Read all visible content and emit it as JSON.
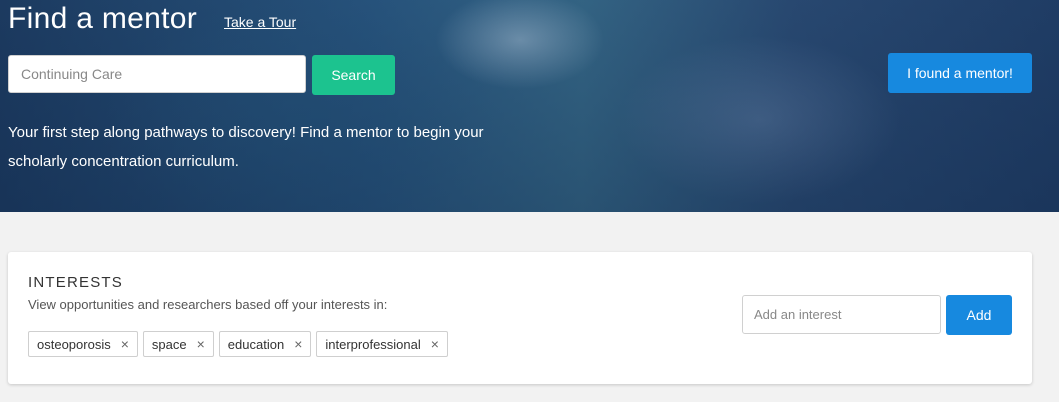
{
  "header": {
    "title": "Find a mentor",
    "tour_link": "Take a Tour",
    "search_placeholder": "Continuing Care",
    "search_button": "Search",
    "found_button": "I found a mentor!",
    "tagline": "Your first step along pathways to discovery! Find a mentor to begin your scholarly concentration curriculum."
  },
  "interests": {
    "heading": "INTERESTS",
    "description": "View opportunities and researchers based off your interests in:",
    "tags": [
      "osteoporosis",
      "space",
      "education",
      "interprofessional"
    ],
    "close_glyph": "×",
    "input_placeholder": "Add an interest",
    "add_button": "Add"
  },
  "colors": {
    "search_button": "#1cc38f",
    "primary_button": "#1789df"
  }
}
